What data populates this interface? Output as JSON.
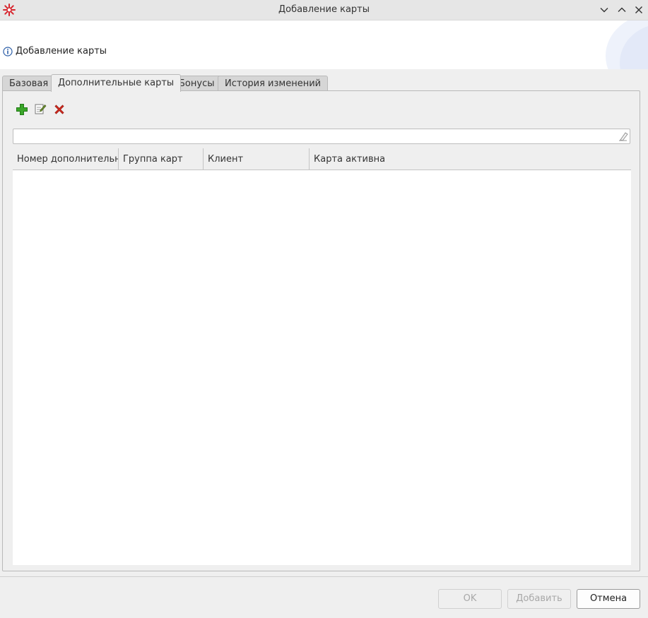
{
  "window": {
    "title": "Добавление карты",
    "controls": [
      "chevron-down-icon",
      "chevron-up-icon",
      "close-icon"
    ]
  },
  "banner": {
    "title": "Добавление карты",
    "icon": "info-icon"
  },
  "tabs": [
    {
      "label": "Базовая",
      "active": false
    },
    {
      "label": "Дополнительные карты",
      "active": true
    },
    {
      "label": "Бонусы",
      "active": false
    },
    {
      "label": "История изменений",
      "active": false
    }
  ],
  "toolbar": {
    "buttons": [
      {
        "icon": "add-icon",
        "color": "#3aa629"
      },
      {
        "icon": "edit-icon",
        "color": "#6c8c2e"
      },
      {
        "icon": "delete-icon",
        "color": "#d62b1f"
      }
    ]
  },
  "filter": {
    "value": "",
    "placeholder": "",
    "clear_icon": "eraser-icon"
  },
  "table": {
    "columns": [
      "Номер дополнительн",
      "Группа карт",
      "Клиент",
      "Карта активна"
    ],
    "rows": []
  },
  "footer": {
    "ok_label": "OK",
    "ok_enabled": false,
    "add_label": "Добавить",
    "add_enabled": false,
    "cancel_label": "Отмена",
    "cancel_enabled": true
  },
  "colors": {
    "app_icon": "#d7262f",
    "background": "#efefef"
  }
}
